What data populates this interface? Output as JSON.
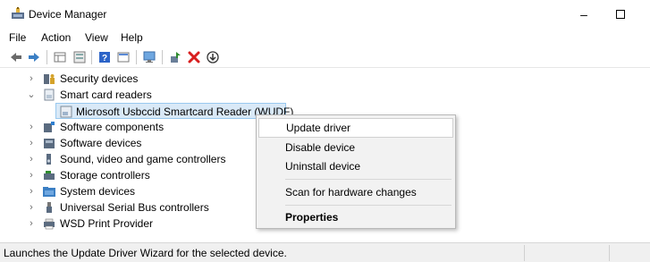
{
  "window": {
    "title": "Device Manager",
    "minimize_glyph": "–"
  },
  "menu": [
    "File",
    "Action",
    "View",
    "Help"
  ],
  "toolbar": {
    "buttons": [
      "back-arrow-icon",
      "forward-arrow-icon",
      "properties-grid-icon",
      "device-list-icon",
      "help-icon",
      "view-icon",
      "monitor-icon",
      "update-driver-icon",
      "uninstall-x-icon",
      "download-circle-icon"
    ],
    "colors": {
      "arrow": "#3b7fc4",
      "green": "#2e8b2e",
      "red": "#d81e1e"
    }
  },
  "tree": {
    "items": [
      {
        "label": "Security devices",
        "chevron": "›",
        "icon": "security-key-icon"
      },
      {
        "label": "Smart card readers",
        "chevron": "⌄",
        "icon": "smartcard-reader-icon"
      },
      {
        "label": "Microsoft Usbccid Smartcard Reader (WUDF)",
        "chevron": "",
        "icon": "smartcard-icon"
      },
      {
        "label": "Software components",
        "chevron": "›",
        "icon": "software-component-icon"
      },
      {
        "label": "Software devices",
        "chevron": "›",
        "icon": "software-device-icon"
      },
      {
        "label": "Sound, video and game controllers",
        "chevron": "›",
        "icon": "speaker-icon"
      },
      {
        "label": "Storage controllers",
        "chevron": "›",
        "icon": "storage-controller-icon"
      },
      {
        "label": "System devices",
        "chevron": "›",
        "icon": "system-folder-icon"
      },
      {
        "label": "Universal Serial Bus controllers",
        "chevron": "›",
        "icon": "usb-icon"
      },
      {
        "label": "WSD Print Provider",
        "chevron": "›",
        "icon": "printer-icon"
      }
    ],
    "selected_color": "#d9e9f7"
  },
  "context_menu": {
    "items": [
      {
        "label": "Update driver"
      },
      {
        "label": "Disable device"
      },
      {
        "label": "Uninstall device"
      },
      {
        "label": "Scan for hardware changes"
      },
      {
        "label": "Properties"
      }
    ]
  },
  "status": {
    "text": "Launches the Update Driver Wizard for the selected device."
  }
}
